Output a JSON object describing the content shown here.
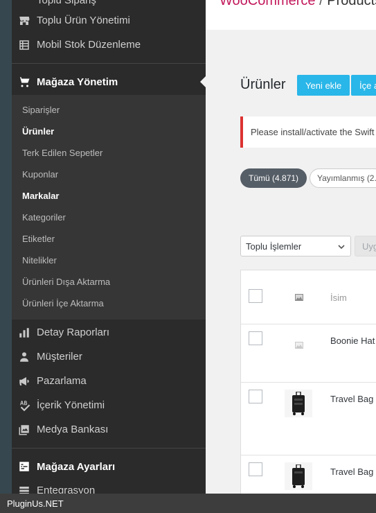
{
  "sidebar": {
    "partial_top_label": "Toplu Sipariş",
    "top_items": [
      {
        "label": "Toplu Ürün Yönetimi",
        "icon": "store-icon"
      },
      {
        "label": "Mobil Stok Düzenleme",
        "icon": "list-icon"
      }
    ],
    "store_section": {
      "label": "Mağaza Yönetim",
      "icon": "cart-icon"
    },
    "sub_items": [
      {
        "label": "Siparişler",
        "bold": false
      },
      {
        "label": "Ürünler",
        "bold": true
      },
      {
        "label": "Terk Edilen Sepetler",
        "bold": false
      },
      {
        "label": "Kuponlar",
        "bold": false
      },
      {
        "label": "Markalar",
        "bold": true
      },
      {
        "label": "Kategoriler",
        "bold": false
      },
      {
        "label": "Etiketler",
        "bold": false
      },
      {
        "label": "Nitelikler",
        "bold": false
      },
      {
        "label": "Ürünleri Dışa Aktarma",
        "bold": false
      },
      {
        "label": "Ürünleri İçe Aktarma",
        "bold": false
      }
    ],
    "bottom_items": [
      {
        "label": "Detay Raporları",
        "icon": "bar-chart-icon"
      },
      {
        "label": "Müşteriler",
        "icon": "user-icon"
      },
      {
        "label": "Pazarlama",
        "icon": "megaphone-icon"
      },
      {
        "label": "İçerik Yönetimi",
        "icon": "spellcheck-icon"
      },
      {
        "label": "Medya Bankası",
        "icon": "media-icon"
      }
    ],
    "settings_section": {
      "label": "Mağaza Ayarları",
      "icon": "settings-box-icon"
    },
    "partial_bottom_item": {
      "label": "Entegrasyon",
      "icon": "integration-icon"
    }
  },
  "topbar": {
    "brand": "WooCommerce",
    "separator": " / ",
    "page": "Products"
  },
  "main": {
    "title": "Ürünler",
    "add_new_label": "Yeni ekle",
    "import_label": "İçe aktar",
    "notice_text": "Please install/activate the Swift",
    "filter_all_label": "Tümü",
    "filter_all_count": "(4.871)",
    "filter_published_label": "Yayımlanmış",
    "filter_published_count": "(2.",
    "bulk_actions_label": "Toplu İşlemler",
    "apply_label": "Uygula",
    "column_name": "İsim",
    "rows": [
      {
        "name": "Boonie Hat"
      },
      {
        "name": "Travel Bag"
      },
      {
        "name": "Travel Bag"
      }
    ]
  },
  "footer": {
    "text": "PluginUs.NET"
  },
  "colors": {
    "sidebar_bg": "#2b2b2b",
    "submenu_bg": "#363636",
    "rail": "#37474f",
    "accent_button": "#29b6e8",
    "brand": "#c2185b",
    "notice_border": "#dc3232",
    "filter_active": "#555d66"
  }
}
